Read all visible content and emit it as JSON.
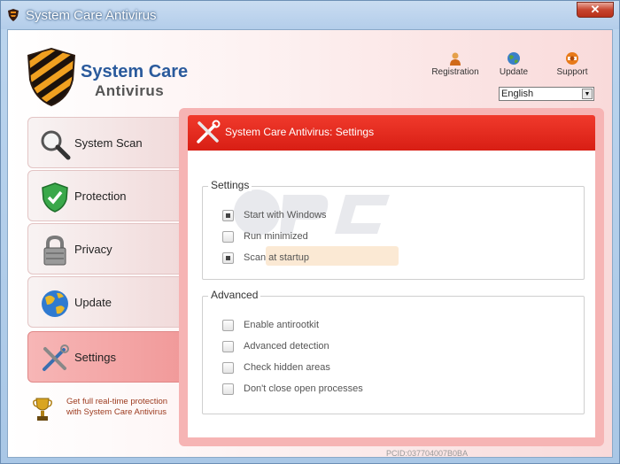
{
  "window": {
    "title": "System Care Antivirus",
    "close_label": "✕"
  },
  "logo": {
    "line1": "System Care",
    "line2": "Antivirus"
  },
  "toplinks": [
    {
      "label": "Registration",
      "icon": "person-icon"
    },
    {
      "label": "Update",
      "icon": "globe-icon"
    },
    {
      "label": "Support",
      "icon": "support-icon"
    }
  ],
  "language": {
    "selected": "English"
  },
  "nav": [
    {
      "label": "System Scan",
      "icon": "magnifier-icon",
      "active": false
    },
    {
      "label": "Protection",
      "icon": "shield-check-icon",
      "active": false
    },
    {
      "label": "Privacy",
      "icon": "padlock-icon",
      "active": false
    },
    {
      "label": "Update",
      "icon": "globe-icon",
      "active": false
    },
    {
      "label": "Settings",
      "icon": "tools-icon",
      "active": true
    }
  ],
  "promo": {
    "text": "Get full real-time protection with System Care Antivirus"
  },
  "panel": {
    "title": "System Care Antivirus: Settings",
    "settings_group": {
      "title": "Settings",
      "options": [
        {
          "label": "Start with Windows",
          "checked": true
        },
        {
          "label": "Run minimized",
          "checked": false
        },
        {
          "label": "Scan at startup",
          "checked": true
        }
      ]
    },
    "advanced_group": {
      "title": "Advanced",
      "options": [
        {
          "label": "Enable antirootkit",
          "checked": false
        },
        {
          "label": "Advanced detection",
          "checked": false
        },
        {
          "label": "Check hidden areas",
          "checked": false
        },
        {
          "label": "Don't close open processes",
          "checked": false
        }
      ]
    }
  },
  "footer": {
    "pcid": "PCID:037704007B0BA"
  },
  "colors": {
    "accent_red": "#e02418",
    "logo_blue": "#2a5a9c",
    "promo_text": "#9c3a1e"
  }
}
